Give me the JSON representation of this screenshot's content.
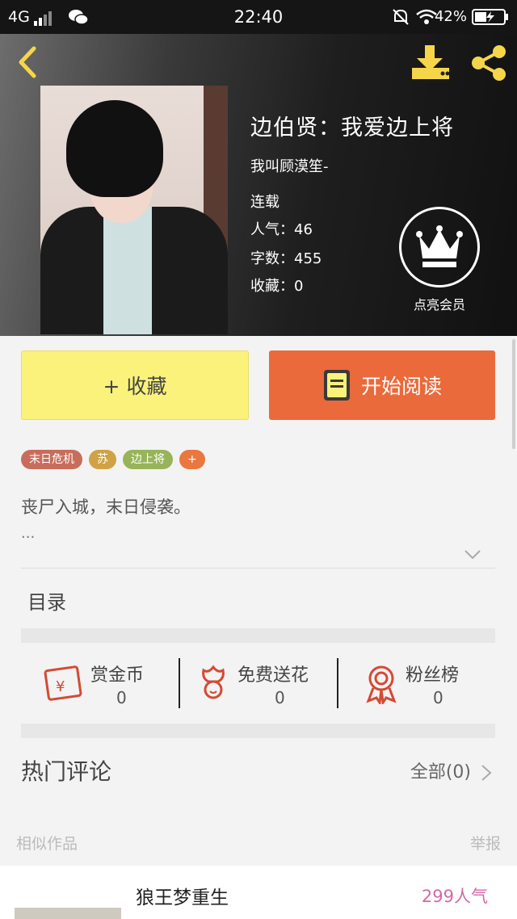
{
  "statusbar": {
    "network": "4G",
    "time": "22:40",
    "battery": "42%"
  },
  "book": {
    "title": "边伯贤：我爱边上将",
    "author": "我叫顾漠笙-",
    "status": "连载",
    "popularity": "人气：46",
    "word_count": "字数：455",
    "favorites": "收藏：0"
  },
  "vip": {
    "label": "点亮会员"
  },
  "actions": {
    "collect": "+ 收藏",
    "read": "开始阅读"
  },
  "tags": [
    {
      "label": "末日危机",
      "color": "#c86d5c"
    },
    {
      "label": "苏",
      "color": "#d0a246"
    },
    {
      "label": "边上将",
      "color": "#98b45a"
    },
    {
      "label": "+",
      "color": "#e9773f"
    }
  ],
  "summary": {
    "text": "丧尸入城，末日侵袭。",
    "more": "..."
  },
  "toc": {
    "label": "目录"
  },
  "stats": [
    {
      "label": "赏金币",
      "value": "0"
    },
    {
      "label": "免费送花",
      "value": "0"
    },
    {
      "label": "粉丝榜",
      "value": "0"
    }
  ],
  "comments": {
    "title": "热门评论",
    "all": "全部(0)"
  },
  "similar": {
    "label": "相似作品",
    "report": "举报"
  },
  "recommend": {
    "name": "狼王梦重生",
    "popularity": "299人气"
  },
  "colors": {
    "accent_yellow": "#fbf27b",
    "accent_orange": "#ea6a3b",
    "icon_red": "#d44a34",
    "crown_gold": "#f5d64a"
  }
}
